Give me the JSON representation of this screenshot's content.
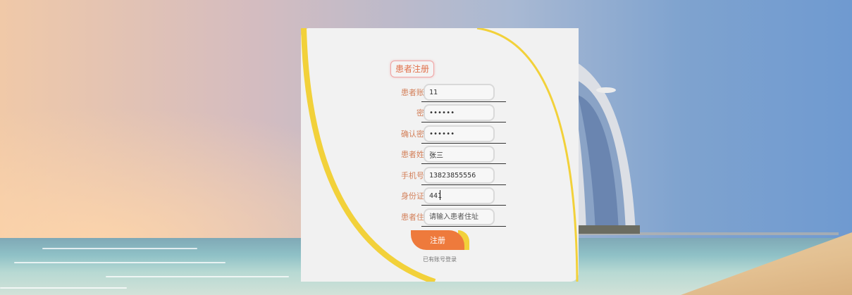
{
  "form": {
    "title": "患者注册",
    "fields": [
      {
        "label": "患者账号:",
        "value": "11",
        "placeholder": ""
      },
      {
        "label": "密码:",
        "value": "••••••",
        "placeholder": ""
      },
      {
        "label": "确认密码:",
        "value": "••••••",
        "placeholder": ""
      },
      {
        "label": "患者姓名:",
        "value": "张三",
        "placeholder": ""
      },
      {
        "label": "手机号码:",
        "value": "13823855556",
        "placeholder": ""
      },
      {
        "label": "身份证号:",
        "value": "441",
        "placeholder": ""
      },
      {
        "label": "患者住址:",
        "value": "",
        "placeholder": "请输入患者住址"
      }
    ],
    "submit_label": "注册",
    "login_link": "已有账号登录"
  },
  "colors": {
    "accent": "#ee7a3c",
    "edge": "#f2d13a",
    "label": "#d3805a"
  }
}
